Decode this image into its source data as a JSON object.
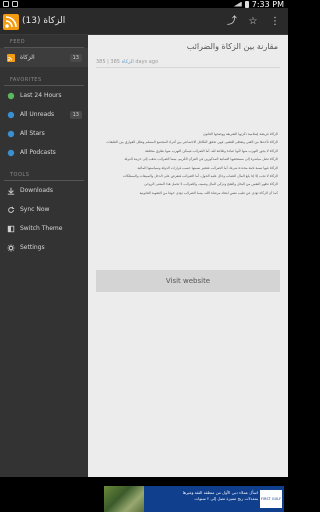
{
  "status_bar": {
    "time": "7:33 PM"
  },
  "action_bar": {
    "title": "الزكاة (13)",
    "icons": [
      "rss-app-icon",
      "share-icon",
      "star-icon",
      "menu-icon"
    ],
    "share_glyph": "⤴",
    "star_glyph": "☆",
    "menu_glyph": "⋮"
  },
  "sidebar": {
    "feed_header": "FEED",
    "feed_item": {
      "label": "الزكاة",
      "count": "13"
    },
    "favorites_header": "FAVORITES",
    "favorites": [
      {
        "label": "Last 24 Hours",
        "icon": "clock-icon"
      },
      {
        "label": "All Unreads",
        "count": "13",
        "icon": "unread-icon"
      },
      {
        "label": "All Stars",
        "icon": "star-icon"
      },
      {
        "label": "All Podcasts",
        "icon": "podcast-icon"
      }
    ],
    "tools_header": "TOOLS",
    "tools": [
      {
        "label": "Downloads",
        "icon": "download-icon"
      },
      {
        "label": "Sync Now",
        "icon": "sync-icon"
      },
      {
        "label": "Switch Theme",
        "icon": "theme-icon"
      },
      {
        "label": "Settings",
        "icon": "settings-icon"
      }
    ]
  },
  "article": {
    "title": "مقارنة بين الزكاة والضرائب",
    "meta_feed": "الزكاة",
    "meta_age": "385 days ago",
    "meta_prefix": "385 | ",
    "body": [
      "الزكاة فريضة إسلامية ذكرتها الشريعة ووضحها القانون",
      "الزكاة تأخذها من الغني وتعطى للفقير، فهي تحقق التكافل الاجتماعي بين أفراد المجتمع المسلم وتقلل الفوارق بين الطبقات",
      "الزكاة لا يجوز التهرب منها لأنها عبادة وطاعة لله، أما الضرائب فيمكن التهرب منها بطرق مختلفة",
      "الزكاة تصل مباشرة إلى مستحقيها الثمانية المذكورين في القرآن الكريم، بينما الضرائب تذهب إلى خزينة الدولة",
      "الزكاة فيها نسبة ثابتة محددة شرعا، أما الضرائب فتتغير نسبتها حسب قرارات الدولة وسياستها المالية",
      "الزكاة لا تجب إلا إذا بلغ المال النصاب وحال عليه الحول، أما الضرائب فتفرض على الدخل والمبيعات والممتلكات",
      "الزكاة تطهر النفس من البخل والشح وتزكي المال وتنميه، والضرائب لا تحمل هذا المعنى الروحي",
      "كما أن الزكاة تؤدى عن طيب نفس ابتغاء مرضاة الله، بينما الضرائب تؤدى خوفا من العقوبة القانونية"
    ],
    "visit_label": "Visit website"
  },
  "ad": {
    "line1": "اسأل عملاء دبي الأول من منطقة الثقة وغيرها",
    "line2": "بمعدلات ربح مميزة تصل إلى ٢ سنوات",
    "logo_text": "FIRST GULF BANK"
  }
}
